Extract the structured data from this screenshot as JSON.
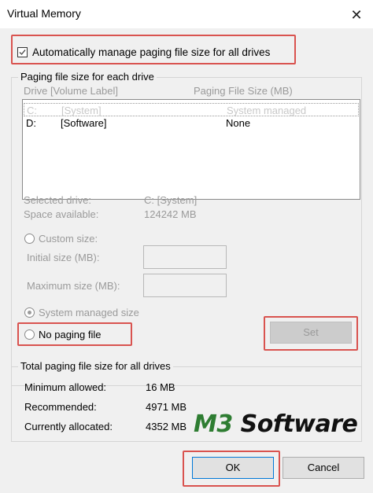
{
  "window": {
    "title": "Virtual Memory",
    "close_glyph": "✕"
  },
  "auto_manage": {
    "label": "Automatically manage paging file size for all drives",
    "checked": true
  },
  "paging_group": {
    "legend": "Paging file size for each drive",
    "col_drive": "Drive  [Volume Label]",
    "col_size": "Paging File Size (MB)",
    "drives": [
      {
        "drive": "C:",
        "label": "[System]",
        "size": "System managed"
      },
      {
        "drive": "D:",
        "label": "[Software]",
        "size": "None"
      }
    ]
  },
  "selected": {
    "drive_label": "Selected drive:",
    "drive_value": "C:  [System]",
    "space_label": "Space available:",
    "space_value": "124242 MB"
  },
  "custom": {
    "label": "Custom size:",
    "initial_label": "Initial size (MB):",
    "initial_value": "",
    "max_label": "Maximum size (MB):",
    "max_value": ""
  },
  "system_managed": {
    "label": "System managed size"
  },
  "no_paging": {
    "label": "No paging file"
  },
  "set_button": {
    "label": "Set"
  },
  "totals": {
    "legend": "Total paging file size for all drives",
    "min_label": "Minimum allowed:",
    "min_value": "16 MB",
    "rec_label": "Recommended:",
    "rec_value": "4971 MB",
    "cur_label": "Currently allocated:",
    "cur_value": "4352 MB"
  },
  "watermark": {
    "brand_a": "M3",
    "brand_b": " Software"
  },
  "ok_button": {
    "label": "OK"
  },
  "cancel_button": {
    "label": "Cancel"
  },
  "colors": {
    "highlight": "#d9534f",
    "selection": "#0078d7"
  }
}
